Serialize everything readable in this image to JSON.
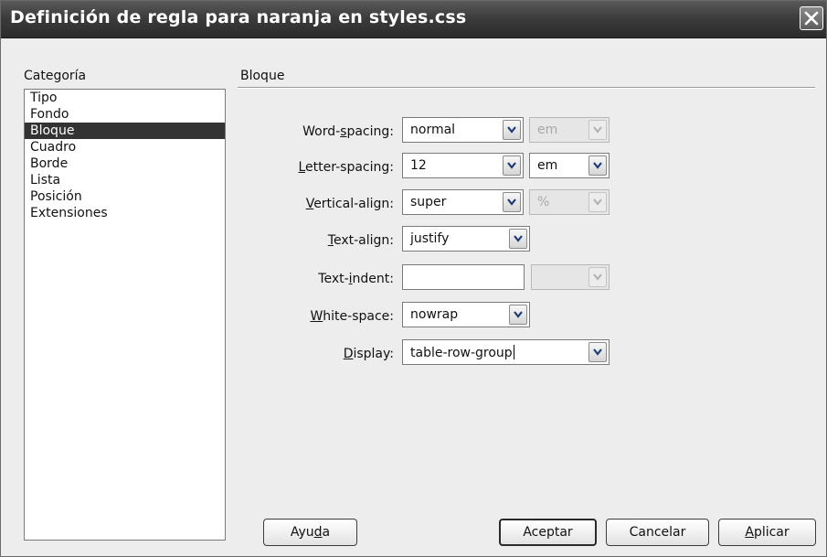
{
  "window": {
    "title": "Definición de regla para naranja en styles.css"
  },
  "category": {
    "label": "Categoría",
    "items": [
      "Tipo",
      "Fondo",
      "Bloque",
      "Cuadro",
      "Borde",
      "Lista",
      "Posición",
      "Extensiones"
    ],
    "selected": "Bloque"
  },
  "section": {
    "title": "Bloque"
  },
  "fields": {
    "word_spacing": {
      "label_pre": "Word-",
      "label_u": "s",
      "label_post": "pacing:",
      "value": "normal",
      "unit": "em"
    },
    "letter_spacing": {
      "label_pre": "",
      "label_u": "L",
      "label_post": "etter-spacing:",
      "value": "12",
      "unit": "em"
    },
    "vertical_align": {
      "label_pre": "",
      "label_u": "V",
      "label_post": "ertical-align:",
      "value": "super",
      "unit": "%"
    },
    "text_align": {
      "label_pre": "",
      "label_u": "T",
      "label_post": "ext-align:",
      "value": "justify"
    },
    "text_indent": {
      "label_pre": "Text-",
      "label_u": "i",
      "label_post": "ndent:",
      "value": "",
      "unit": ""
    },
    "white_space": {
      "label_pre": "",
      "label_u": "W",
      "label_post": "hite-space:",
      "value": "nowrap"
    },
    "display": {
      "label_pre": "",
      "label_u": "D",
      "label_post": "isplay:",
      "value": "table-row-group"
    }
  },
  "buttons": {
    "help": {
      "pre": "Ayu",
      "u": "d",
      "post": "a"
    },
    "ok": "Aceptar",
    "cancel": "Cancelar",
    "apply": {
      "pre": "",
      "u": "A",
      "post": "plicar"
    }
  }
}
